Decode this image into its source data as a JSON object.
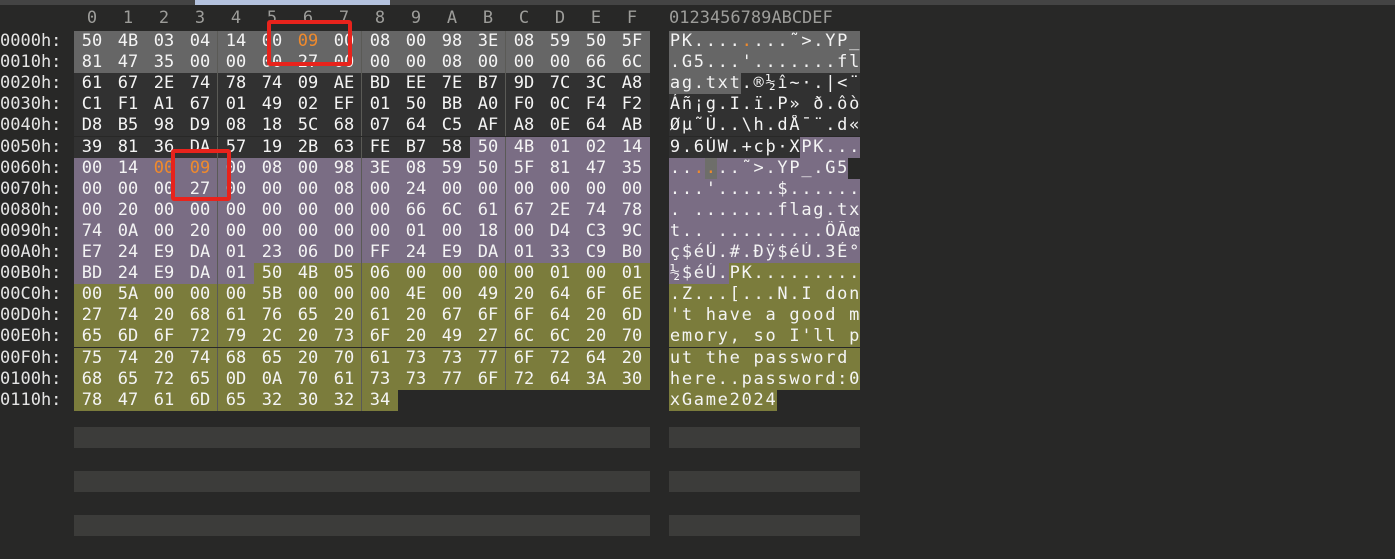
{
  "column_headers": [
    "0",
    "1",
    "2",
    "3",
    "4",
    "5",
    "6",
    "7",
    "8",
    "9",
    "A",
    "B",
    "C",
    "D",
    "E",
    "F"
  ],
  "ascii_header": "0123456789ABCDEF",
  "colors": {
    "background": "#282827",
    "region_gray": "#666666",
    "region_dark": "#313131",
    "region_purple": "#7a6d84",
    "region_olive": "#7b7c3c",
    "highlight_text": "#f08a2c",
    "annotation_box": "#e8231c"
  },
  "rows": [
    {
      "offset": "0000h:",
      "bytes": [
        "50",
        "4B",
        "03",
        "04",
        "14",
        "00",
        "09",
        "00",
        "08",
        "00",
        "98",
        "3E",
        "08",
        "59",
        "50",
        "5F"
      ],
      "ascii": "PK........˜>.YP_"
    },
    {
      "offset": "0010h:",
      "bytes": [
        "81",
        "47",
        "35",
        "00",
        "00",
        "00",
        "27",
        "00",
        "00",
        "00",
        "08",
        "00",
        "00",
        "00",
        "66",
        "6C"
      ],
      "ascii": ".G5...'.......fl"
    },
    {
      "offset": "0020h:",
      "bytes": [
        "61",
        "67",
        "2E",
        "74",
        "78",
        "74",
        "09",
        "AE",
        "BD",
        "EE",
        "7E",
        "B7",
        "9D",
        "7C",
        "3C",
        "A8"
      ],
      "ascii": "ag.txt.®½î~·.|<¨"
    },
    {
      "offset": "0030h:",
      "bytes": [
        "C1",
        "F1",
        "A1",
        "67",
        "01",
        "49",
        "02",
        "EF",
        "01",
        "50",
        "BB",
        "A0",
        "F0",
        "0C",
        "F4",
        "F2"
      ],
      "ascii": "Áñ¡g.I.ï.P» ð.ôò"
    },
    {
      "offset": "0040h:",
      "bytes": [
        "D8",
        "B5",
        "98",
        "D9",
        "08",
        "18",
        "5C",
        "68",
        "07",
        "64",
        "C5",
        "AF",
        "A8",
        "0E",
        "64",
        "AB"
      ],
      "ascii": "Øµ˜Ù..\\h.dÅ¯¨.d«"
    },
    {
      "offset": "0050h:",
      "bytes": [
        "39",
        "81",
        "36",
        "DA",
        "57",
        "19",
        "2B",
        "63",
        "FE",
        "B7",
        "58",
        "50",
        "4B",
        "01",
        "02",
        "14"
      ],
      "ascii": "9.6ÚW.+cþ·XPK..."
    },
    {
      "offset": "0060h:",
      "bytes": [
        "00",
        "14",
        "00",
        "09",
        "00",
        "08",
        "00",
        "98",
        "3E",
        "08",
        "59",
        "50",
        "5F",
        "81",
        "47",
        "35"
      ],
      "ascii": "......˜>.YP_.G5"
    },
    {
      "offset": "0070h:",
      "bytes": [
        "00",
        "00",
        "00",
        "27",
        "00",
        "00",
        "00",
        "08",
        "00",
        "24",
        "00",
        "00",
        "00",
        "00",
        "00",
        "00"
      ],
      "ascii": "...'.....$......"
    },
    {
      "offset": "0080h:",
      "bytes": [
        "00",
        "20",
        "00",
        "00",
        "00",
        "00",
        "00",
        "00",
        "00",
        "66",
        "6C",
        "61",
        "67",
        "2E",
        "74",
        "78"
      ],
      "ascii": ". .......flag.tx"
    },
    {
      "offset": "0090h:",
      "bytes": [
        "74",
        "0A",
        "00",
        "20",
        "00",
        "00",
        "00",
        "00",
        "00",
        "01",
        "00",
        "18",
        "00",
        "D4",
        "C3",
        "9C"
      ],
      "ascii": "t.. .........ÔÃœ"
    },
    {
      "offset": "00A0h:",
      "bytes": [
        "E7",
        "24",
        "E9",
        "DA",
        "01",
        "23",
        "06",
        "D0",
        "FF",
        "24",
        "E9",
        "DA",
        "01",
        "33",
        "C9",
        "B0"
      ],
      "ascii": "ç$éÚ.#.Ðÿ$éÚ.3É°"
    },
    {
      "offset": "00B0h:",
      "bytes": [
        "BD",
        "24",
        "E9",
        "DA",
        "01",
        "50",
        "4B",
        "05",
        "06",
        "00",
        "00",
        "00",
        "00",
        "01",
        "00",
        "01"
      ],
      "ascii": "½$éÚ.PK........."
    },
    {
      "offset": "00C0h:",
      "bytes": [
        "00",
        "5A",
        "00",
        "00",
        "00",
        "5B",
        "00",
        "00",
        "00",
        "4E",
        "00",
        "49",
        "20",
        "64",
        "6F",
        "6E"
      ],
      "ascii": ".Z...[...N.I don"
    },
    {
      "offset": "00D0h:",
      "bytes": [
        "27",
        "74",
        "20",
        "68",
        "61",
        "76",
        "65",
        "20",
        "61",
        "20",
        "67",
        "6F",
        "6F",
        "64",
        "20",
        "6D"
      ],
      "ascii": "'t have a good m"
    },
    {
      "offset": "00E0h:",
      "bytes": [
        "65",
        "6D",
        "6F",
        "72",
        "79",
        "2C",
        "20",
        "73",
        "6F",
        "20",
        "49",
        "27",
        "6C",
        "6C",
        "20",
        "70"
      ],
      "ascii": "emory, so I'll p"
    },
    {
      "offset": "00F0h:",
      "bytes": [
        "75",
        "74",
        "20",
        "74",
        "68",
        "65",
        "20",
        "70",
        "61",
        "73",
        "73",
        "77",
        "6F",
        "72",
        "64",
        "20"
      ],
      "ascii": "ut the password "
    },
    {
      "offset": "0100h:",
      "bytes": [
        "68",
        "65",
        "72",
        "65",
        "0D",
        "0A",
        "70",
        "61",
        "73",
        "73",
        "77",
        "6F",
        "72",
        "64",
        "3A",
        "30"
      ],
      "ascii": "here..password:0"
    },
    {
      "offset": "0110h:",
      "bytes": [
        "78",
        "47",
        "61",
        "6D",
        "65",
        "32",
        "30",
        "32",
        "34"
      ],
      "ascii": "xGame2024"
    }
  ]
}
